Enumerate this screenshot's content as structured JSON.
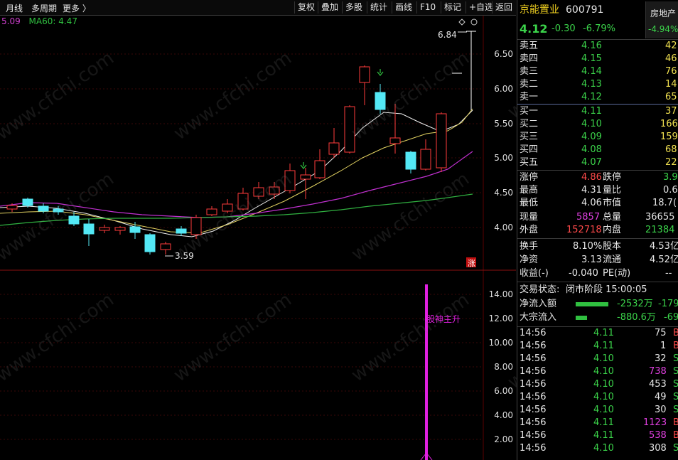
{
  "toolbar": {
    "left": [
      {
        "label": "月线"
      },
      {
        "label": "多周期"
      },
      {
        "label": "更多 〉"
      }
    ],
    "buttons": [
      {
        "label": "复权"
      },
      {
        "label": "叠加"
      },
      {
        "label": "多股"
      },
      {
        "label": "统计"
      },
      {
        "label": "画线"
      },
      {
        "label": "F10"
      },
      {
        "label": "标记"
      },
      {
        "label": "+自选"
      },
      {
        "label": "返回"
      }
    ]
  },
  "legend": {
    "ma_prev": "5.09",
    "ma60_label": "MA60: 4.47"
  },
  "watermark": "www.cfchi.com",
  "chart": {
    "y_labels": [
      "6.50",
      "6.00",
      "5.50",
      "5.00",
      "4.50",
      "4.00"
    ],
    "annot_high": "6.84",
    "annot_low": "3.59",
    "zhang_label": "涨",
    "sub_y_labels": [
      "14.00",
      "12.00",
      "10.00",
      "8.00",
      "6.00",
      "4.00",
      "2.00"
    ],
    "signal_label": "股神主升",
    "colors": {
      "up": "#ff3b3b",
      "down": "#53e8f5",
      "ma1": "#ffffff",
      "ma2": "#e0d060",
      "ma3": "#c030d0",
      "ma4": "#30b040",
      "signal": "#e020e0"
    }
  },
  "stock": {
    "name": "京能置业",
    "code": "600791",
    "sector": "房地产",
    "sector_change": "-4.94%",
    "price": "4.12",
    "change": "-0.30",
    "change_pct": "-6.79%"
  },
  "order_book": {
    "asks": [
      {
        "label": "卖五",
        "price": "4.16",
        "vol": "42"
      },
      {
        "label": "卖四",
        "price": "4.15",
        "vol": "46"
      },
      {
        "label": "卖三",
        "price": "4.14",
        "vol": "76"
      },
      {
        "label": "卖二",
        "price": "4.13",
        "vol": "14"
      },
      {
        "label": "卖一",
        "price": "4.12",
        "vol": "65"
      }
    ],
    "bids": [
      {
        "label": "买一",
        "price": "4.11",
        "vol": "37"
      },
      {
        "label": "买二",
        "price": "4.10",
        "vol": "166"
      },
      {
        "label": "买三",
        "price": "4.09",
        "vol": "159"
      },
      {
        "label": "买四",
        "price": "4.08",
        "vol": "68"
      },
      {
        "label": "买五",
        "price": "4.07",
        "vol": "22"
      }
    ]
  },
  "stats": [
    {
      "k1": "涨停",
      "v1": "4.86",
      "c1": "red",
      "k2": "跌停",
      "v2": "3.9",
      "c2": "green"
    },
    {
      "k1": "最高",
      "v1": "4.31",
      "c1": "white",
      "k2": "量比",
      "v2": "0.6",
      "c2": "white"
    },
    {
      "k1": "最低",
      "v1": "4.06",
      "c1": "white",
      "k2": "市值",
      "v2": "18.7(",
      "c2": "white"
    },
    {
      "k1": "现量",
      "v1": "5857",
      "c1": "mag",
      "k2": "总量",
      "v2": "36655",
      "c2": "white"
    },
    {
      "k1": "外盘",
      "v1": "152718",
      "c1": "red",
      "k2": "内盘",
      "v2": "21384",
      "c2": "green"
    }
  ],
  "stats2": [
    {
      "k1": "换手",
      "v1": "8.10%",
      "k2": "股本",
      "v2": "4.53亿"
    },
    {
      "k1": "净资",
      "v1": "3.13",
      "k2": "流通",
      "v2": "4.52亿"
    },
    {
      "k1": "收益(-)",
      "v1": "-0.040",
      "k2": "PE(动)",
      "v2": "--"
    }
  ],
  "trade_status": {
    "label": "交易状态:",
    "value": "闭市阶段 15:00:05"
  },
  "flows": [
    {
      "label": "净流入额",
      "value": "-2532万",
      "pct": "-179"
    },
    {
      "label": "大宗流入",
      "value": "-880.6万",
      "pct": "-69"
    }
  ],
  "ticks": [
    {
      "t": "14:56",
      "p": "4.11",
      "pc": "green",
      "v": "75",
      "vc": "white",
      "f": "B"
    },
    {
      "t": "14:56",
      "p": "4.11",
      "pc": "green",
      "v": "1",
      "vc": "white",
      "f": "B"
    },
    {
      "t": "14:56",
      "p": "4.10",
      "pc": "green",
      "v": "32",
      "vc": "white",
      "f": "S"
    },
    {
      "t": "14:56",
      "p": "4.10",
      "pc": "green",
      "v": "738",
      "vc": "mag",
      "f": "S"
    },
    {
      "t": "14:56",
      "p": "4.10",
      "pc": "green",
      "v": "453",
      "vc": "white",
      "f": "S"
    },
    {
      "t": "14:56",
      "p": "4.10",
      "pc": "green",
      "v": "49",
      "vc": "white",
      "f": "S"
    },
    {
      "t": "14:56",
      "p": "4.10",
      "pc": "green",
      "v": "30",
      "vc": "white",
      "f": "S"
    },
    {
      "t": "14:56",
      "p": "4.11",
      "pc": "green",
      "v": "1123",
      "vc": "mag",
      "f": "B"
    },
    {
      "t": "14:56",
      "p": "4.11",
      "pc": "green",
      "v": "538",
      "vc": "mag",
      "f": "B"
    },
    {
      "t": "14:56",
      "p": "4.10",
      "pc": "green",
      "v": "308",
      "vc": "white",
      "f": "S"
    }
  ]
}
